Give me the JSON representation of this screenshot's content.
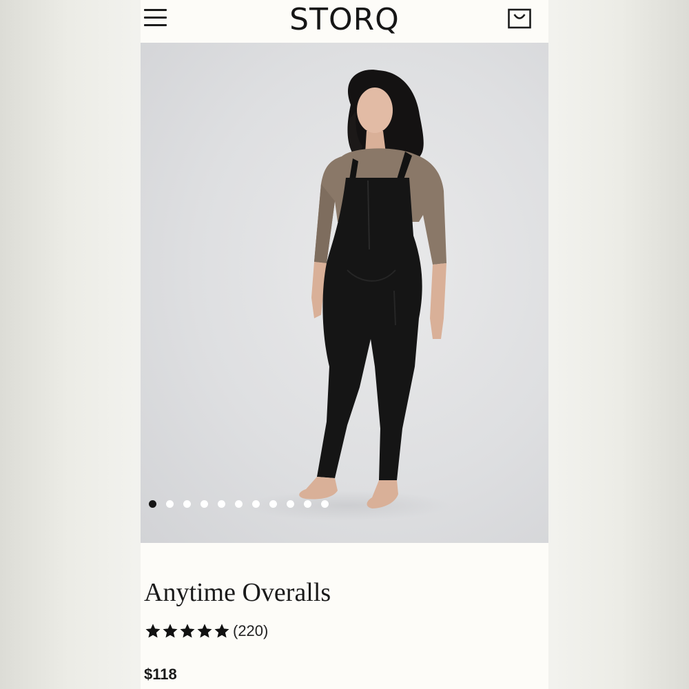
{
  "header": {
    "brand": "STORQ",
    "menu_icon": "hamburger-menu-icon",
    "cart_icon": "shopping-bag-icon"
  },
  "gallery": {
    "image_count": 11,
    "active_index": 0,
    "image_alt": "Model wearing Anytime Overalls"
  },
  "product": {
    "title": "Anytime Overalls",
    "rating_stars": 5,
    "review_count": "(220)",
    "price": "$118"
  },
  "colors": {
    "page_background": "#fdfcf8",
    "text": "#1a1a1a",
    "dot_active": "#151515",
    "dot_inactive": "#ffffff"
  }
}
